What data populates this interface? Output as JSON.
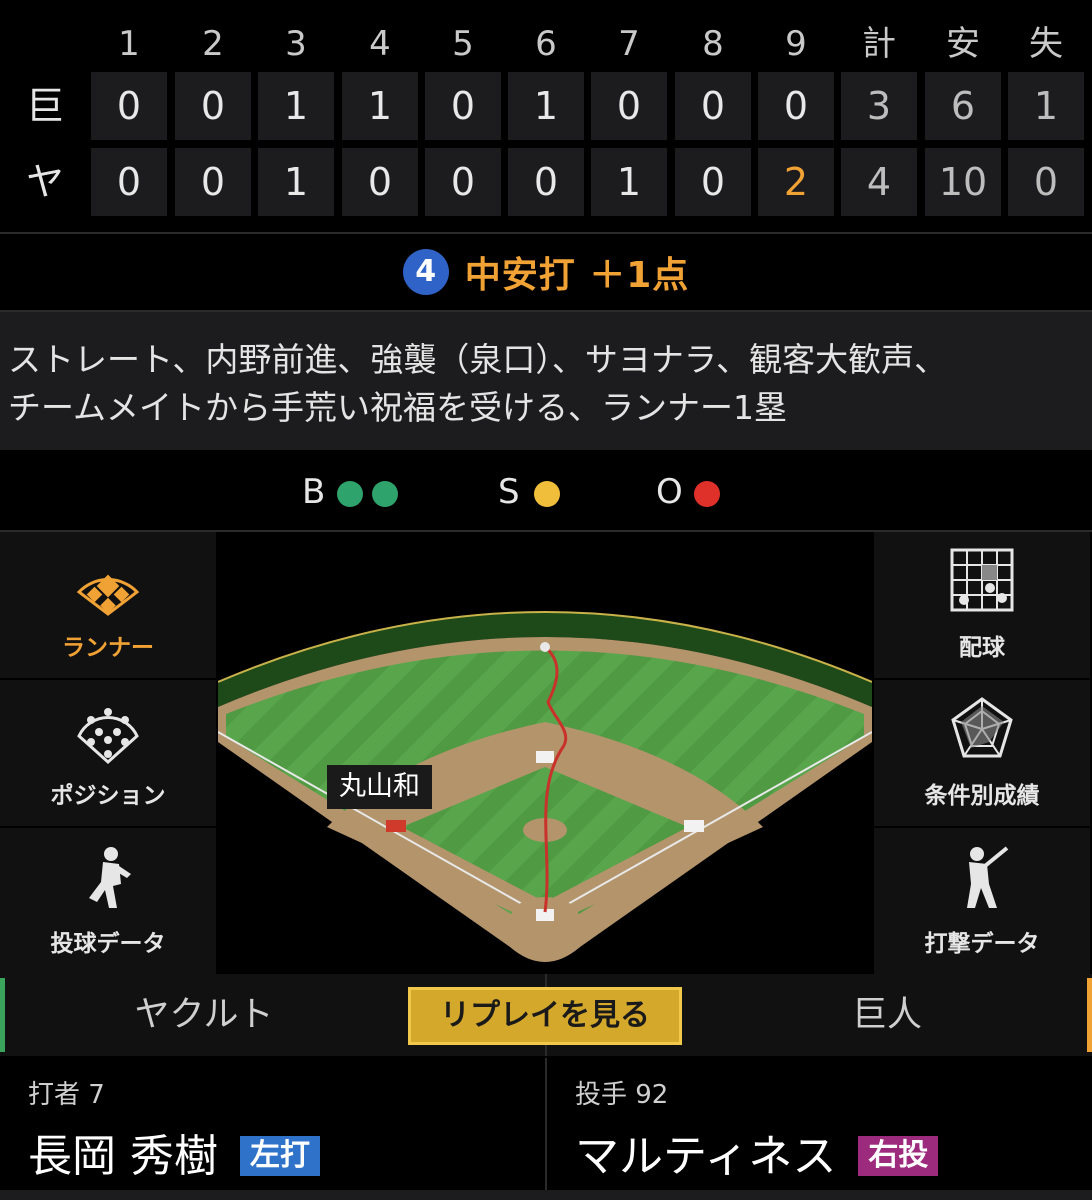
{
  "scoreboard": {
    "innings": [
      "1",
      "2",
      "3",
      "4",
      "5",
      "6",
      "7",
      "8",
      "9"
    ],
    "totals_labels": [
      "計",
      "安",
      "失"
    ],
    "teams": [
      {
        "abbr": "巨",
        "runs": [
          "0",
          "0",
          "1",
          "1",
          "0",
          "1",
          "0",
          "0",
          "0"
        ],
        "totals": [
          "3",
          "6",
          "1"
        ]
      },
      {
        "abbr": "ヤ",
        "runs": [
          "0",
          "0",
          "1",
          "0",
          "0",
          "0",
          "1",
          "0",
          "2"
        ],
        "totals": [
          "4",
          "10",
          "0"
        ]
      }
    ],
    "highlight_color": "#f1a235"
  },
  "play": {
    "batting_order": "4",
    "result": "中安打 ＋1点",
    "description_lines": [
      "ストレート、内野前進、強襲（泉口）、サヨナラ、観客大歓声、",
      "チームメイトから手荒い祝福を受ける、ランナー1塁"
    ]
  },
  "count": {
    "ball_label": "B",
    "balls": 2,
    "strike_label": "S",
    "strikes": 1,
    "out_label": "O",
    "outs": 1
  },
  "side_menu": {
    "left": [
      {
        "label": "ランナー",
        "icon": "runner-diamond-icon",
        "active": true
      },
      {
        "label": "ポジション",
        "icon": "position-icon",
        "active": false
      },
      {
        "label": "投球データ",
        "icon": "pitcher-icon",
        "active": false
      }
    ],
    "right": [
      {
        "label": "配球",
        "icon": "pitch-grid-icon"
      },
      {
        "label": "条件別成績",
        "icon": "radar-chart-icon"
      },
      {
        "label": "打撃データ",
        "icon": "batter-icon"
      }
    ]
  },
  "field": {
    "runner_tag": "丸山和"
  },
  "tabs": {
    "left_team": "ヤクルト",
    "replay": "リプレイを見る",
    "right_team": "巨人"
  },
  "batter": {
    "role": "打者 7",
    "name": "長岡 秀樹",
    "hand": "左打"
  },
  "pitcher": {
    "role": "投手 92",
    "name": "マルティネス",
    "hand": "右投"
  }
}
